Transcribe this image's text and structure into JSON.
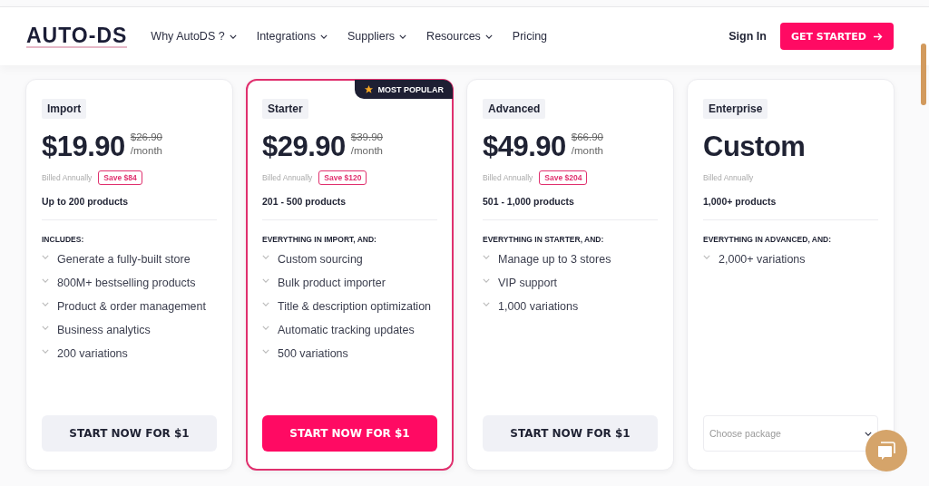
{
  "header": {
    "logo": "AUTO-DS",
    "nav": [
      {
        "label": "Why AutoDS ?",
        "dropdown": true
      },
      {
        "label": "Integrations",
        "dropdown": true
      },
      {
        "label": "Suppliers",
        "dropdown": true
      },
      {
        "label": "Resources",
        "dropdown": true
      },
      {
        "label": "Pricing",
        "dropdown": false
      }
    ],
    "sign_in": "Sign In",
    "cta": "GET STARTED"
  },
  "plans": [
    {
      "name": "Import",
      "featured": false,
      "kind": "price",
      "price": "$19.90",
      "old_price": "$26.90",
      "period": "/month",
      "billing": "Billed Annually",
      "save": "Save $84",
      "products": "Up to 200 products",
      "includes_title": "INCLUDES:",
      "features": [
        "Generate a fully-built store",
        "800M+ bestselling products",
        "Product & order management",
        "Business analytics",
        "200  variations"
      ],
      "action": {
        "kind": "button",
        "label": "START NOW FOR $1"
      }
    },
    {
      "name": "Starter",
      "featured": true,
      "badge": "MOST POPULAR",
      "kind": "price",
      "price": "$29.90",
      "old_price": "$39.90",
      "period": "/month",
      "billing": "Billed Annually",
      "save": "Save $120",
      "products": "201 - 500 products",
      "includes_title": "EVERYTHING IN IMPORT, AND:",
      "features": [
        "Custom sourcing",
        "Bulk product importer",
        "Title & description optimization",
        "Automatic tracking updates",
        "500  variations"
      ],
      "action": {
        "kind": "button",
        "label": "START NOW FOR $1"
      }
    },
    {
      "name": "Advanced",
      "featured": false,
      "kind": "price",
      "price": "$49.90",
      "old_price": "$66.90",
      "period": "/month",
      "billing": "Billed Annually",
      "save": "Save $204",
      "products": "501 - 1,000 products",
      "includes_title": "EVERYTHING IN STARTER, AND:",
      "features": [
        "Manage up to 3 stores",
        "VIP support",
        "1,000 variations"
      ],
      "action": {
        "kind": "button",
        "label": "START NOW FOR $1"
      }
    },
    {
      "name": "Enterprise",
      "featured": false,
      "kind": "custom",
      "price": "Custom",
      "billing": "Billed Annually",
      "products": "1,000+ products",
      "includes_title": "EVERYTHING IN ADVANCED, AND:",
      "features": [
        "2,000+ variations"
      ],
      "action": {
        "kind": "select",
        "placeholder": "Choose package"
      }
    }
  ]
}
